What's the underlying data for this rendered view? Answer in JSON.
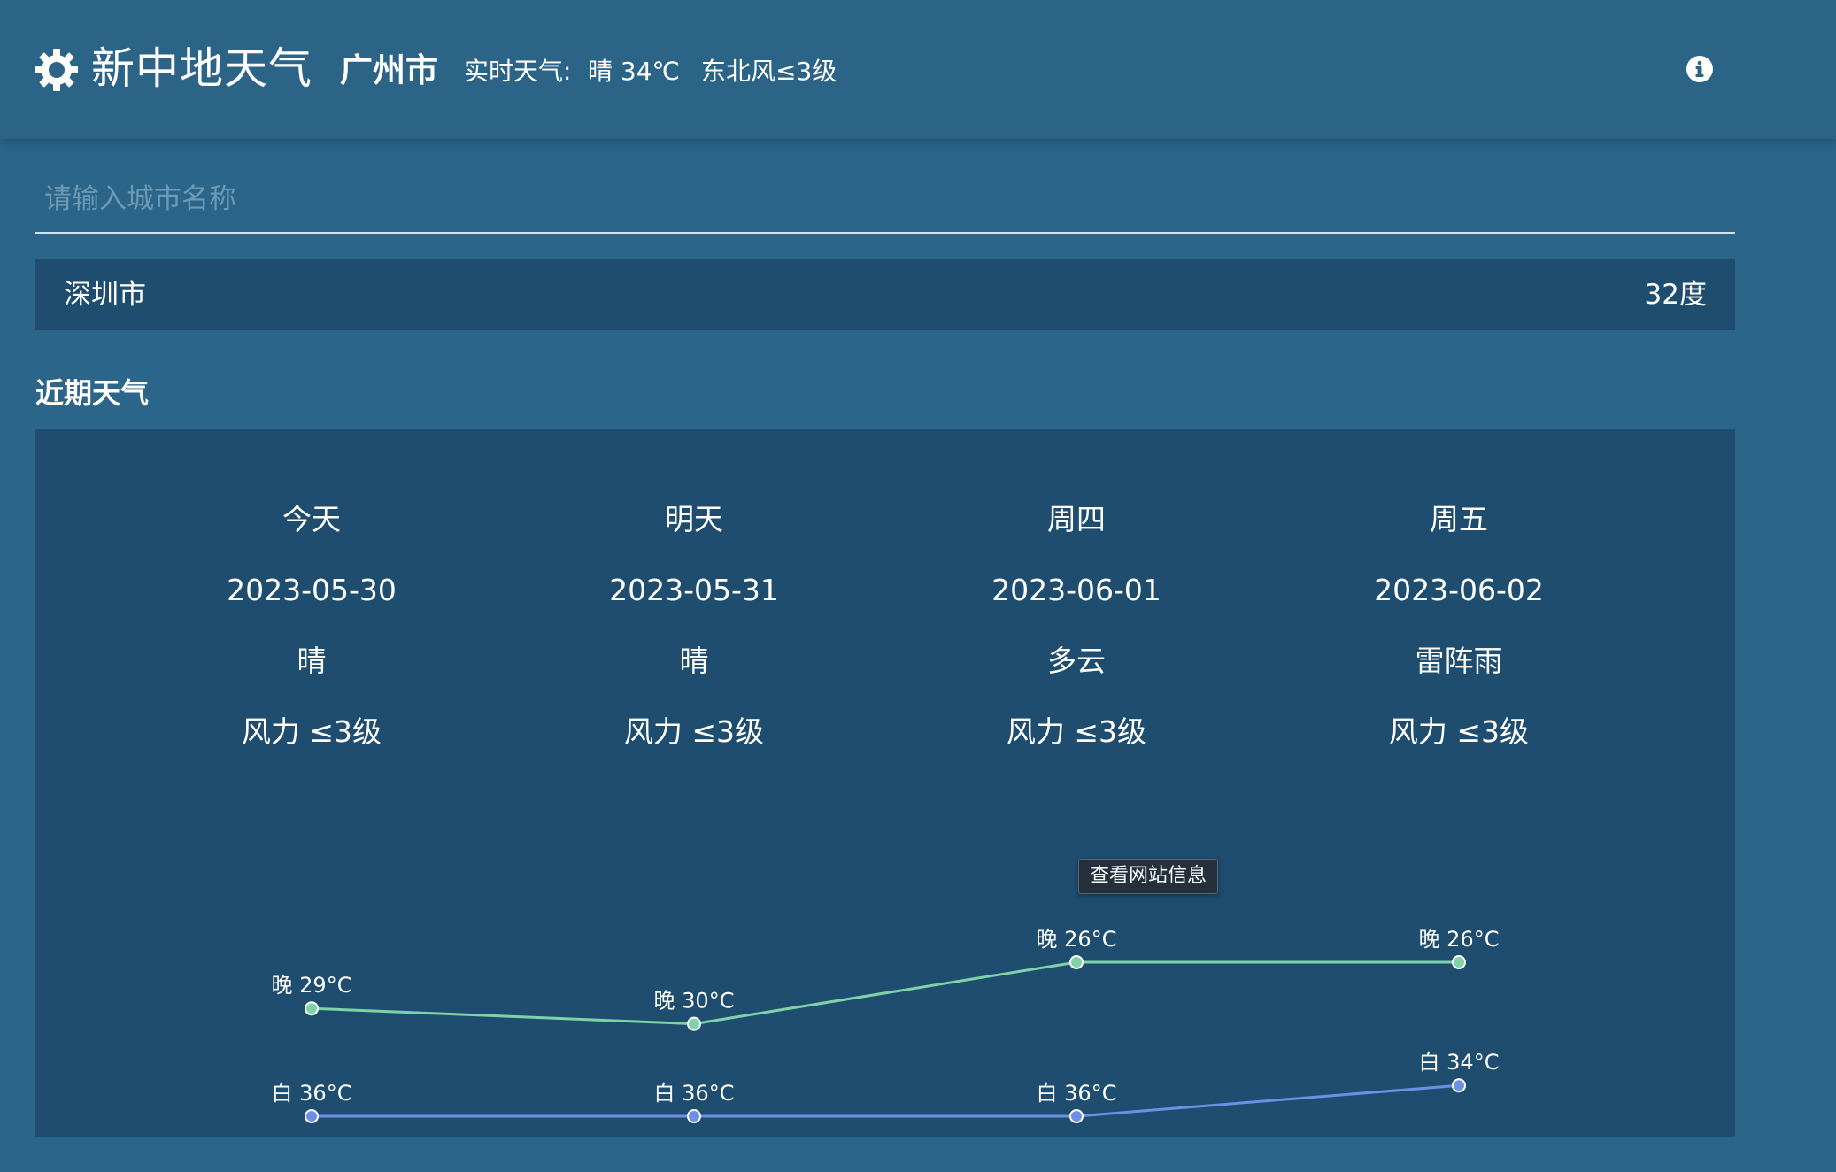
{
  "header": {
    "app_title": "新中地天气",
    "city": "广州市",
    "realtime_label": "实时天气:",
    "realtime_value": "晴 34℃",
    "wind": "东北风≤3级",
    "logo_icon": "sun-gear-icon",
    "info_icon": "info-icon"
  },
  "search": {
    "placeholder": "请输入城市名称",
    "value": ""
  },
  "result": {
    "city": "深圳市",
    "temp": "32度"
  },
  "section_title": "近期天气",
  "days": [
    {
      "label": "今天",
      "date": "2023-05-30",
      "weather": "晴",
      "wind": "风力 ≤3级"
    },
    {
      "label": "明天",
      "date": "2023-05-31",
      "weather": "晴",
      "wind": "风力 ≤3级"
    },
    {
      "label": "周四",
      "date": "2023-06-01",
      "weather": "多云",
      "wind": "风力 ≤3级"
    },
    {
      "label": "周五",
      "date": "2023-06-02",
      "weather": "雷阵雨",
      "wind": "风力 ≤3级"
    }
  ],
  "tooltip": "查看网站信息",
  "chart_data": {
    "type": "line",
    "categories": [
      "2023-05-30",
      "2023-05-31",
      "2023-06-01",
      "2023-06-02"
    ],
    "grid": false,
    "series": [
      {
        "name": "晚",
        "values": [
          29,
          30,
          26,
          26
        ],
        "labels": [
          "晚  29°C",
          "晚  30°C",
          "晚  26°C",
          "晚  26°C"
        ],
        "color": "#7fd3a8"
      },
      {
        "name": "白",
        "values": [
          36,
          36,
          36,
          34
        ],
        "labels": [
          "白  36°C",
          "白  36°C",
          "白  36°C",
          "白  34°C"
        ],
        "color": "#6f8fe6"
      }
    ]
  },
  "colors": {
    "background": "#2b6589",
    "panel": "#1f4d6f",
    "night_line": "#7fd3a8",
    "day_line": "#6f8fe6"
  }
}
